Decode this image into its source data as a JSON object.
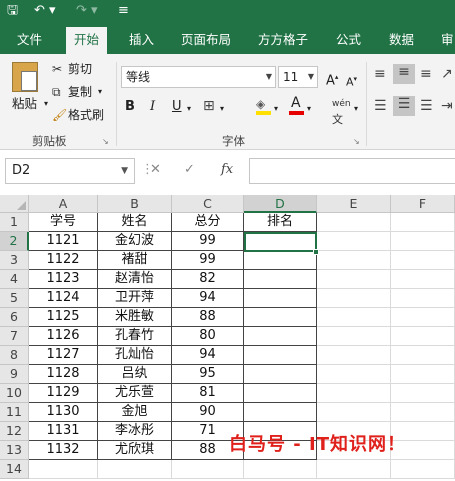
{
  "qat": {
    "save_icon": "save-icon",
    "undo_icon": "undo-icon",
    "redo_icon": "redo-icon",
    "customize_icon": "customize-icon"
  },
  "tabs": [
    "文件",
    "开始",
    "插入",
    "页面布局",
    "方方格子",
    "公式",
    "数据",
    "审"
  ],
  "ribbon": {
    "paste": "粘贴",
    "cut": "剪切",
    "copy": "复制",
    "format_painter": "格式刷",
    "clipboard_group": "剪贴板",
    "font_name": "等线",
    "font_size": "11",
    "font_group": "字体",
    "bold": "B",
    "italic": "I",
    "underline": "U",
    "grow": "A",
    "shrink": "A",
    "font_color": "A",
    "phonetic": "wén"
  },
  "formula_bar": {
    "name_box": "D2",
    "cancel": "✕",
    "enter": "✓",
    "fx": "fx",
    "formula": ""
  },
  "columns": [
    "A",
    "B",
    "C",
    "D",
    "E",
    "F"
  ],
  "rows": [
    "1",
    "2",
    "3",
    "4",
    "5",
    "6",
    "7",
    "8",
    "9",
    "10",
    "11",
    "12",
    "13",
    "14"
  ],
  "selected_cell": "D2",
  "sheet": {
    "headers": [
      "学号",
      "姓名",
      "总分",
      "排名"
    ],
    "records": [
      [
        "1121",
        "金幻波",
        "99"
      ],
      [
        "1122",
        "褚甜",
        "99"
      ],
      [
        "1123",
        "赵清怡",
        "82"
      ],
      [
        "1124",
        "卫开萍",
        "94"
      ],
      [
        "1125",
        "米胜敏",
        "88"
      ],
      [
        "1126",
        "孔春竹",
        "80"
      ],
      [
        "1127",
        "孔灿怡",
        "94"
      ],
      [
        "1128",
        "吕纨",
        "95"
      ],
      [
        "1129",
        "尤乐萱",
        "81"
      ],
      [
        "1130",
        "金旭",
        "90"
      ],
      [
        "1131",
        "李冰彤",
        "71"
      ],
      [
        "1132",
        "尤欣琪",
        "88"
      ]
    ]
  },
  "watermark": "白马号 - IT知识网！",
  "colors": {
    "accent": "#217346",
    "watermark": "#e0201b"
  }
}
